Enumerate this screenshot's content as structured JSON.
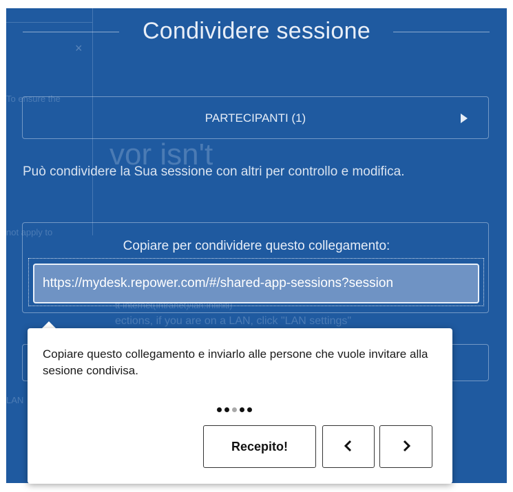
{
  "dialog": {
    "title": "Condividere sessione",
    "participants_label": "PARTECIPANTI (1)",
    "description": "Può condividere la Sua sessione con altri per controllo e modifica.",
    "link_label": "Copiare per condividere questo collegamento:",
    "link_value": "https://mydesk.repower.com/#/shared-app-sessions?session"
  },
  "tooltip": {
    "text": "Copiare questo collegamento e inviarlo alle persone che vuole invitare alla sesione condivisa.",
    "step_total": 5,
    "step_active": 3,
    "ok_label": "Recepito!",
    "prev_icon": "chevron-left-icon",
    "next_icon": "chevron-right-icon"
  },
  "background_ghost": {
    "line1": "To ensure the",
    "line2": "vor isn't",
    "line3": "not apply to",
    "line4": "tt Internet(Intranet)/lan:Infiniti)",
    "line5": "ections, if you are on a LAN, click \"LAN settings\"",
    "line6": "LAN",
    "close_glyph": "×"
  },
  "colors": {
    "overlay_blue": "#1f5aa0",
    "link_field_blue": "#6f93c4",
    "tooltip_bg": "#ffffff"
  }
}
